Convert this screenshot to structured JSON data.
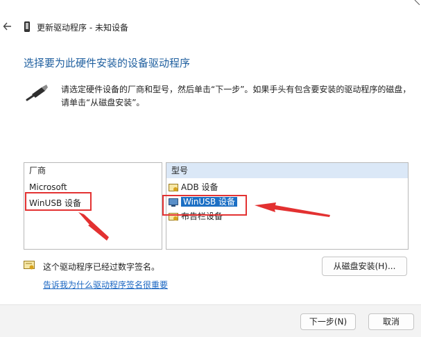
{
  "window": {
    "title": "更新驱动程序 - 未知设备",
    "back_icon": "back-arrow-icon",
    "device_icon": "phone-device-icon"
  },
  "main": {
    "heading": "选择要为此硬件安装的设备驱动程序",
    "instruction": "请选定硬件设备的厂商和型号，然后单击“下一步”。如果手头有包含要安装的驱动程序的磁盘，请单击“从磁盘安装”。",
    "instruction_icon": "usb-cable-icon"
  },
  "manufacturer_list": {
    "header": "厂商",
    "items": [
      "Microsoft",
      "WinUSB 设备"
    ]
  },
  "model_list": {
    "header": "型号",
    "items": [
      {
        "label": "ADB 设备",
        "icon": "driver-certificate-icon",
        "selected": false
      },
      {
        "label": "WinUSB 设备",
        "icon": "monitor-device-icon",
        "selected": true
      },
      {
        "label": "布告栏设备",
        "icon": "driver-certificate-icon",
        "selected": false
      }
    ]
  },
  "signature": {
    "text": "这个驱动程序已经过数字签名。",
    "link": "告诉我为什么驱动程序签名很重要",
    "icon": "certificate-icon"
  },
  "buttons": {
    "have_disk": "从磁盘安装(H)...",
    "next": "下一步(N)",
    "cancel": "取消"
  },
  "colors": {
    "heading": "#1f5f9f",
    "selection": "#1c6fc4",
    "annotation": "#e33131",
    "link": "#1a66c2"
  }
}
